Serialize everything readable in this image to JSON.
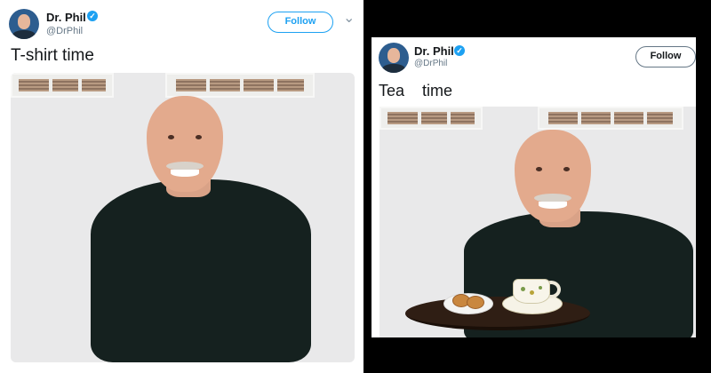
{
  "left_tweet": {
    "name": "Dr. Phil",
    "handle": "@DrPhil",
    "follow_label": "Follow",
    "text": "T-shirt time",
    "verified_glyph": "✓",
    "chevron_glyph": "⌄"
  },
  "right_tweet": {
    "name": "Dr. Phil",
    "handle": "@DrPhil",
    "follow_label": "Follow",
    "text": "Tea    time",
    "verified_glyph": "✓"
  },
  "colors": {
    "twitter_blue": "#1da1f2",
    "shirt": "#15211f",
    "background": "#000000"
  },
  "icons": [
    "verified-badge-icon",
    "chevron-down-icon"
  ]
}
